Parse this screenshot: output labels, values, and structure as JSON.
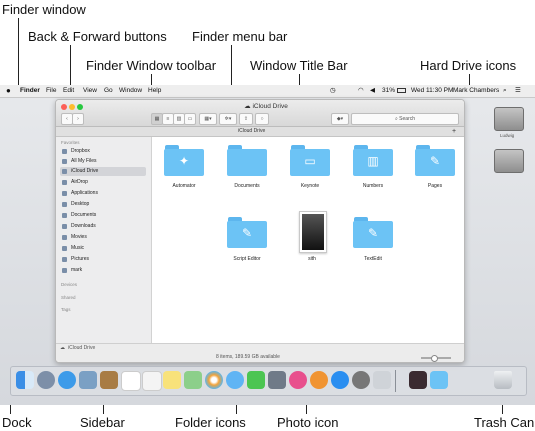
{
  "annotations": {
    "finder_window": "Finder window",
    "back_forward": "Back & Forward buttons",
    "finder_menu_bar": "Finder menu bar",
    "finder_toolbar": "Finder Window toolbar",
    "window_title_bar": "Window Title Bar",
    "hard_drive_icons": "Hard Drive icons",
    "dock": "Dock",
    "sidebar": "Sidebar",
    "folder_icons": "Folder icons",
    "photo_icon": "Photo icon",
    "trash_can": "Trash Can"
  },
  "menubar": {
    "apple": "",
    "items": [
      "Finder",
      "File",
      "Edit",
      "View",
      "Go",
      "Window",
      "Help"
    ],
    "battery": "31%",
    "clock": "Wed 11:30 PM",
    "user": "Mark Chambers"
  },
  "window": {
    "title": "iCloud Drive",
    "tab_label": "iCloud Drive",
    "search_placeholder": "Search",
    "status_text": "8 items, 189.59 GB available",
    "path_label": "iCloud Drive"
  },
  "sidebar": {
    "favorites_header": "Favorites",
    "favorites": [
      "Dropbox",
      "All My Files",
      "iCloud Drive",
      "AirDrop",
      "Applications",
      "Desktop",
      "Documents",
      "Downloads",
      "Movies",
      "Music",
      "Pictures",
      "mark"
    ],
    "selected": "iCloud Drive",
    "devices_header": "Devices",
    "shared_header": "Shared",
    "tags_header": "Tags"
  },
  "folders": [
    {
      "label": "Automator",
      "glyph": "✦"
    },
    {
      "label": "Documents",
      "glyph": ""
    },
    {
      "label": "Keynote",
      "glyph": "▭"
    },
    {
      "label": "Numbers",
      "glyph": "▥"
    },
    {
      "label": "Pages",
      "glyph": "✎"
    },
    {
      "label": "Script Editor",
      "glyph": "✎"
    },
    {
      "label": "sith",
      "glyph": ""
    },
    {
      "label": "TextEdit",
      "glyph": "✎"
    }
  ],
  "desktop_drives": [
    {
      "label": "Ludwig"
    },
    {
      "label": ""
    }
  ],
  "colors": {
    "folder": "#6cc3f5",
    "selection": "#d3d4d8",
    "close": "#fc5f57",
    "minimize": "#fdbc2e",
    "zoom": "#28c840"
  }
}
